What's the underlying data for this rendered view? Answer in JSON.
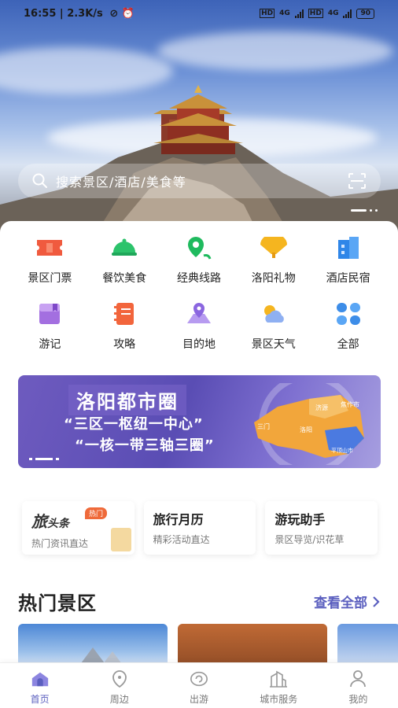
{
  "status_bar": {
    "time": "16:55",
    "speed": "2.3K/s",
    "net1": "4G",
    "net2": "4G",
    "battery": "90"
  },
  "search": {
    "placeholder": "搜索景区/酒店/美食等"
  },
  "categories": [
    {
      "label": "景区门票",
      "icon": "ticket-icon",
      "color": "#f05a3e"
    },
    {
      "label": "餐饮美食",
      "icon": "dish-icon",
      "color": "#2cc36b"
    },
    {
      "label": "经典线路",
      "icon": "route-icon",
      "color": "#1fba5e"
    },
    {
      "label": "洛阳礼物",
      "icon": "fan-icon",
      "color": "#f5b51f"
    },
    {
      "label": "酒店民宿",
      "icon": "hotel-icon",
      "color": "#2f86e8"
    },
    {
      "label": "游记",
      "icon": "notebook-icon",
      "color": "#a36fe0"
    },
    {
      "label": "攻略",
      "icon": "guide-icon",
      "color": "#f2653c"
    },
    {
      "label": "目的地",
      "icon": "location-icon",
      "color": "#8b66e0"
    },
    {
      "label": "景区天气",
      "icon": "weather-icon",
      "color": "#6a8fe8"
    },
    {
      "label": "全部",
      "icon": "grid-icon",
      "color": "#3d8de8"
    }
  ],
  "banner": {
    "title": "洛阳都市圈",
    "line1": "“三区一枢纽一中心”",
    "line2": "“一核一带三轴三圈”",
    "map_labels": [
      "济源",
      "焦作市",
      "三门",
      "洛阳",
      "平顶山市"
    ]
  },
  "feature_cards": [
    {
      "brand": "旅",
      "brand_suffix": "头条",
      "tag": "热门",
      "subtitle": "热门资讯直达"
    },
    {
      "title": "旅行月历",
      "subtitle": "精彩活动直达"
    },
    {
      "title": "游玩助手",
      "subtitle": "景区导览/识花草"
    }
  ],
  "hot_section": {
    "title": "热门景区",
    "link": "查看全部"
  },
  "tabs": [
    {
      "label": "首页",
      "icon": "home-icon",
      "active": true
    },
    {
      "label": "周边",
      "icon": "nearby-icon",
      "active": false
    },
    {
      "label": "出游",
      "icon": "travel-icon",
      "active": false
    },
    {
      "label": "城市服务",
      "icon": "city-icon",
      "active": false
    },
    {
      "label": "我的",
      "icon": "profile-icon",
      "active": false
    }
  ],
  "colors": {
    "accent": "#5b5fbf",
    "banner": "#5a4db4",
    "tag": "#ef6a3a"
  }
}
